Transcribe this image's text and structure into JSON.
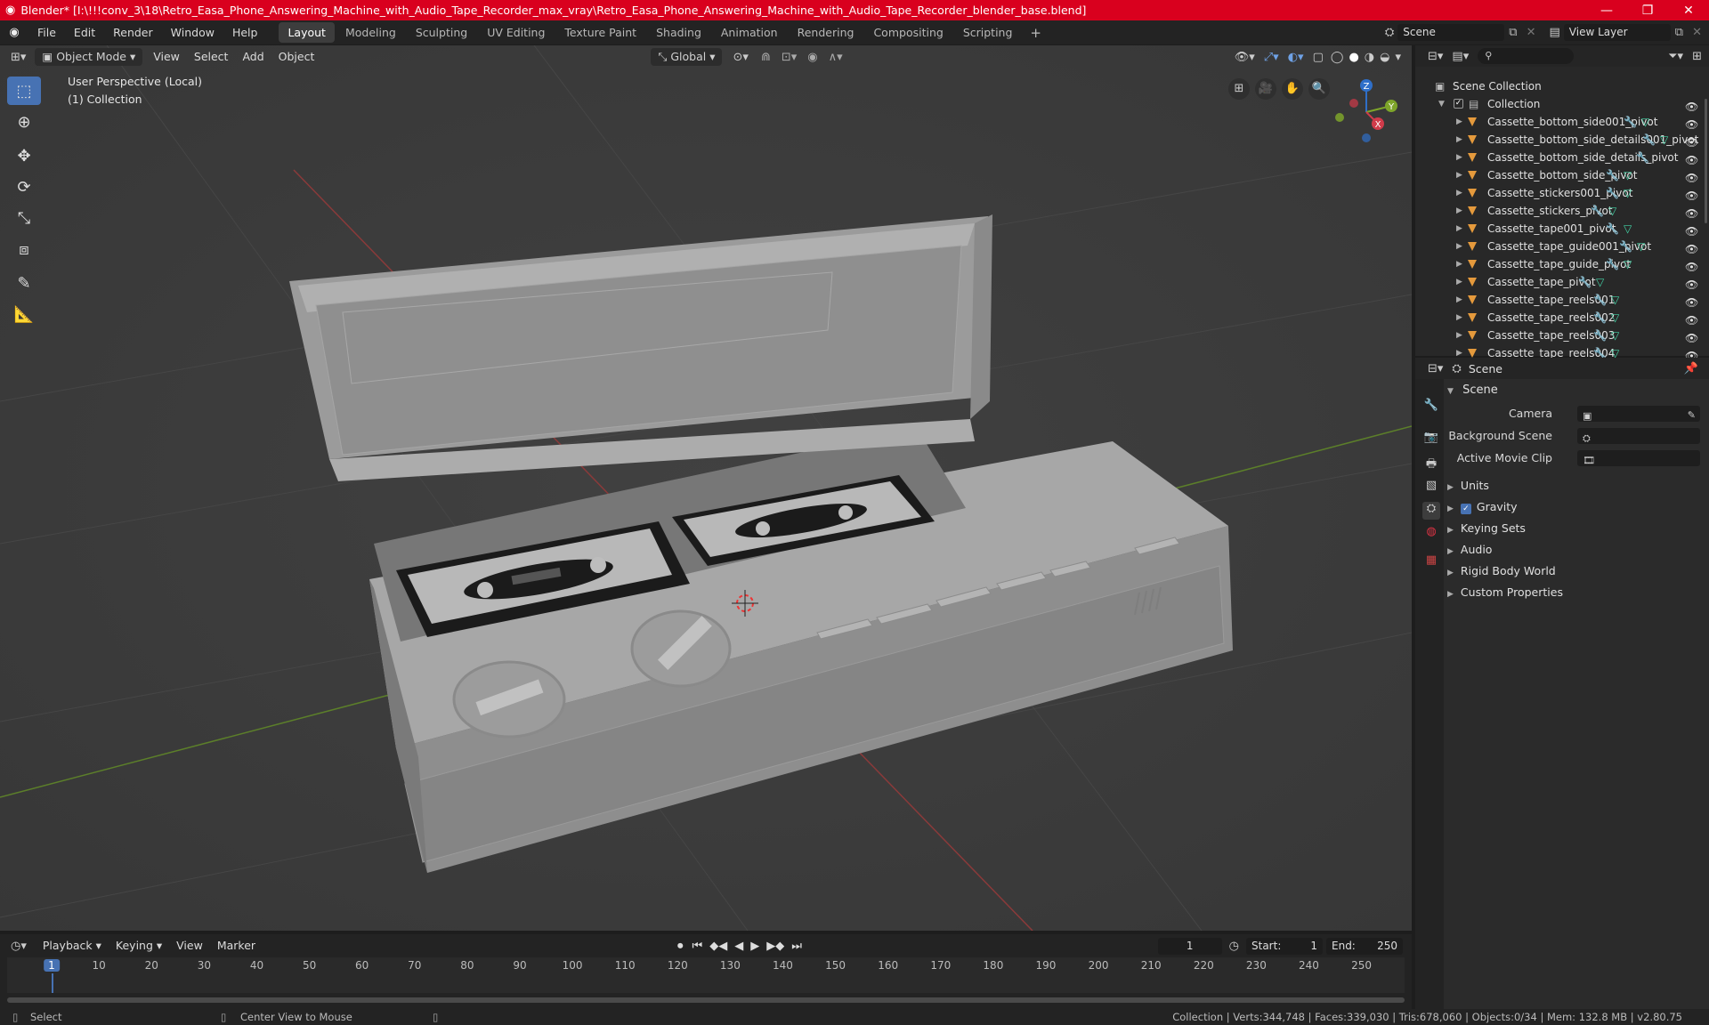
{
  "window": {
    "title": "Blender* [I:\\!!!conv_3\\18\\Retro_Easa_Phone_Answering_Machine_with_Audio_Tape_Recorder_max_vray\\Retro_Easa_Phone_Answering_Machine_with_Audio_Tape_Recorder_blender_base.blend]"
  },
  "menu": [
    "File",
    "Edit",
    "Render",
    "Window",
    "Help"
  ],
  "workspaces": [
    "Layout",
    "Modeling",
    "Sculpting",
    "UV Editing",
    "Texture Paint",
    "Shading",
    "Animation",
    "Rendering",
    "Compositing",
    "Scripting"
  ],
  "scene_field": "Scene",
  "view_layer_field": "View Layer",
  "viewport": {
    "mode": "Object Mode",
    "menus": [
      "View",
      "Select",
      "Add",
      "Object"
    ],
    "orientation": "Global",
    "perspective_label": "User Perspective (Local)",
    "collection_label": "(1) Collection",
    "gizmo": {
      "x": "X",
      "y": "Y",
      "z": "Z"
    }
  },
  "outliner": {
    "root": "Scene Collection",
    "collection": "Collection",
    "items": [
      "Cassette_bottom_side001_pivot",
      "Cassette_bottom_side_details001_pivot",
      "Cassette_bottom_side_details_pivot",
      "Cassette_bottom_side_pivot",
      "Cassette_stickers001_pivot",
      "Cassette_stickers_pivot",
      "Cassette_tape001_pivot",
      "Cassette_tape_guide001_pivot",
      "Cassette_tape_guide_pivot",
      "Cassette_tape_pivot",
      "Cassette_tape_reels001",
      "Cassette_tape_reels002",
      "Cassette_tape_reels003",
      "Cassette_tape_reels004"
    ]
  },
  "properties": {
    "header": "Scene",
    "section": "Scene",
    "camera_label": "Camera",
    "background_scene_label": "Background Scene",
    "active_movie_clip_label": "Active Movie Clip",
    "panels": [
      "Units",
      "Gravity",
      "Keying Sets",
      "Audio",
      "Rigid Body World",
      "Custom Properties"
    ]
  },
  "timeline": {
    "menus": [
      "Playback",
      "Keying",
      "View",
      "Marker"
    ],
    "current_frame": "1",
    "start_label": "Start:",
    "start": "1",
    "end_label": "End:",
    "end": "250",
    "ticks": [
      "1",
      "10",
      "20",
      "30",
      "40",
      "50",
      "60",
      "70",
      "80",
      "90",
      "100",
      "110",
      "120",
      "130",
      "140",
      "150",
      "160",
      "170",
      "180",
      "190",
      "200",
      "210",
      "220",
      "230",
      "240",
      "250"
    ]
  },
  "status": {
    "select": "Select",
    "center": "Center View to Mouse",
    "stats": "Collection | Verts:344,748 | Faces:339,030 | Tris:678,060 | Objects:0/34 | Mem: 132.8 MB | v2.80.75"
  }
}
